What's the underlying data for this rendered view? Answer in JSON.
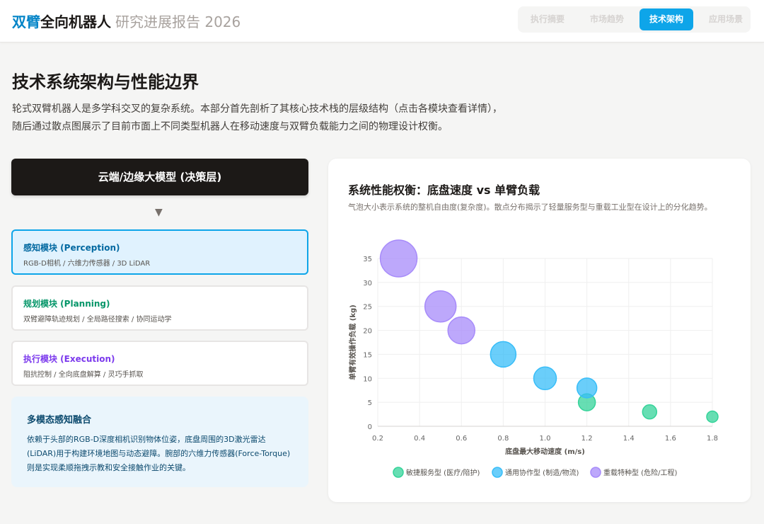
{
  "header": {
    "brand_accent": "双臂",
    "brand_main": "全向机器人",
    "brand_sub": "研究进展报告 2026",
    "nav": [
      {
        "label": "执行摘要",
        "active": false
      },
      {
        "label": "市场趋势",
        "active": false
      },
      {
        "label": "技术架构",
        "active": true
      },
      {
        "label": "应用场景",
        "active": false
      }
    ]
  },
  "main": {
    "title": "技术系统架构与性能边界",
    "intro_line1": "轮式双臂机器人是多学科交叉的复杂系统。本部分首先剖析了其核心技术栈的层级结构（点击各模块查看详情），",
    "intro_line2": "随后通过散点图展示了目前市面上不同类型机器人在移动速度与双臂负载能力之间的物理设计权衡。"
  },
  "architecture": {
    "cloud_label": "云端/边缘大模型 (决策层)",
    "arrow": "▼",
    "modules": [
      {
        "title": "感知模块 (Perception)",
        "desc": "RGB-D相机 / 六维力传感器 / 3D LiDAR",
        "active": true
      },
      {
        "title": "规划模块 (Planning)",
        "desc": "双臂避障轨迹规划 / 全局路径搜索 / 协同运动学",
        "active": false
      },
      {
        "title": "执行模块 (Execution)",
        "desc": "阻抗控制 / 全向底盘解算 / 灵巧手抓取",
        "active": false
      }
    ],
    "detail": {
      "title": "多模态感知融合",
      "body": "依赖于头部的RGB-D深度相机识别物体位姿，底盘周围的3D激光雷达(LiDAR)用于构建环境地图与动态避障。腕部的六维力传感器(Force-Torque)则是实现柔顺拖拽示教和安全接触作业的关键。"
    }
  },
  "chart_card": {
    "title": "系统性能权衡：底盘速度 vs 单臂负载",
    "subtitle": "气泡大小表示系统的整机自由度(复杂度)。散点分布揭示了轻量服务型与重载工业型在设计上的分化趋势。"
  },
  "chart_data": {
    "type": "scatter",
    "xlabel": "底盘最大移动速度 (m/s)",
    "ylabel": "单臂有效操作负载 (kg)",
    "xlim": [
      0.2,
      1.8
    ],
    "ylim": [
      0,
      35
    ],
    "xticks": [
      "0.2",
      "0.4",
      "0.6",
      "0.8",
      "1.0",
      "1.2",
      "1.4",
      "1.6",
      "1.8"
    ],
    "yticks": [
      "0",
      "5",
      "10",
      "15",
      "20",
      "25",
      "30",
      "35"
    ],
    "grid": true,
    "legend_position": "bottom",
    "series": [
      {
        "name": "敏捷服务型 (医疗/陪护)",
        "color": "#34d399",
        "points": [
          {
            "x": 1.2,
            "y": 5,
            "r": 12
          },
          {
            "x": 1.5,
            "y": 3,
            "r": 10
          },
          {
            "x": 1.8,
            "y": 2,
            "r": 8
          }
        ]
      },
      {
        "name": "通用协作型 (制造/物流)",
        "color": "#38bdf8",
        "points": [
          {
            "x": 0.8,
            "y": 15,
            "r": 18
          },
          {
            "x": 1.0,
            "y": 10,
            "r": 16
          },
          {
            "x": 1.2,
            "y": 8,
            "r": 14
          }
        ]
      },
      {
        "name": "重载特种型 (危险/工程)",
        "color": "#a78bfa",
        "points": [
          {
            "x": 0.3,
            "y": 35,
            "r": 26
          },
          {
            "x": 0.5,
            "y": 25,
            "r": 22
          },
          {
            "x": 0.6,
            "y": 20,
            "r": 19
          }
        ]
      }
    ]
  }
}
